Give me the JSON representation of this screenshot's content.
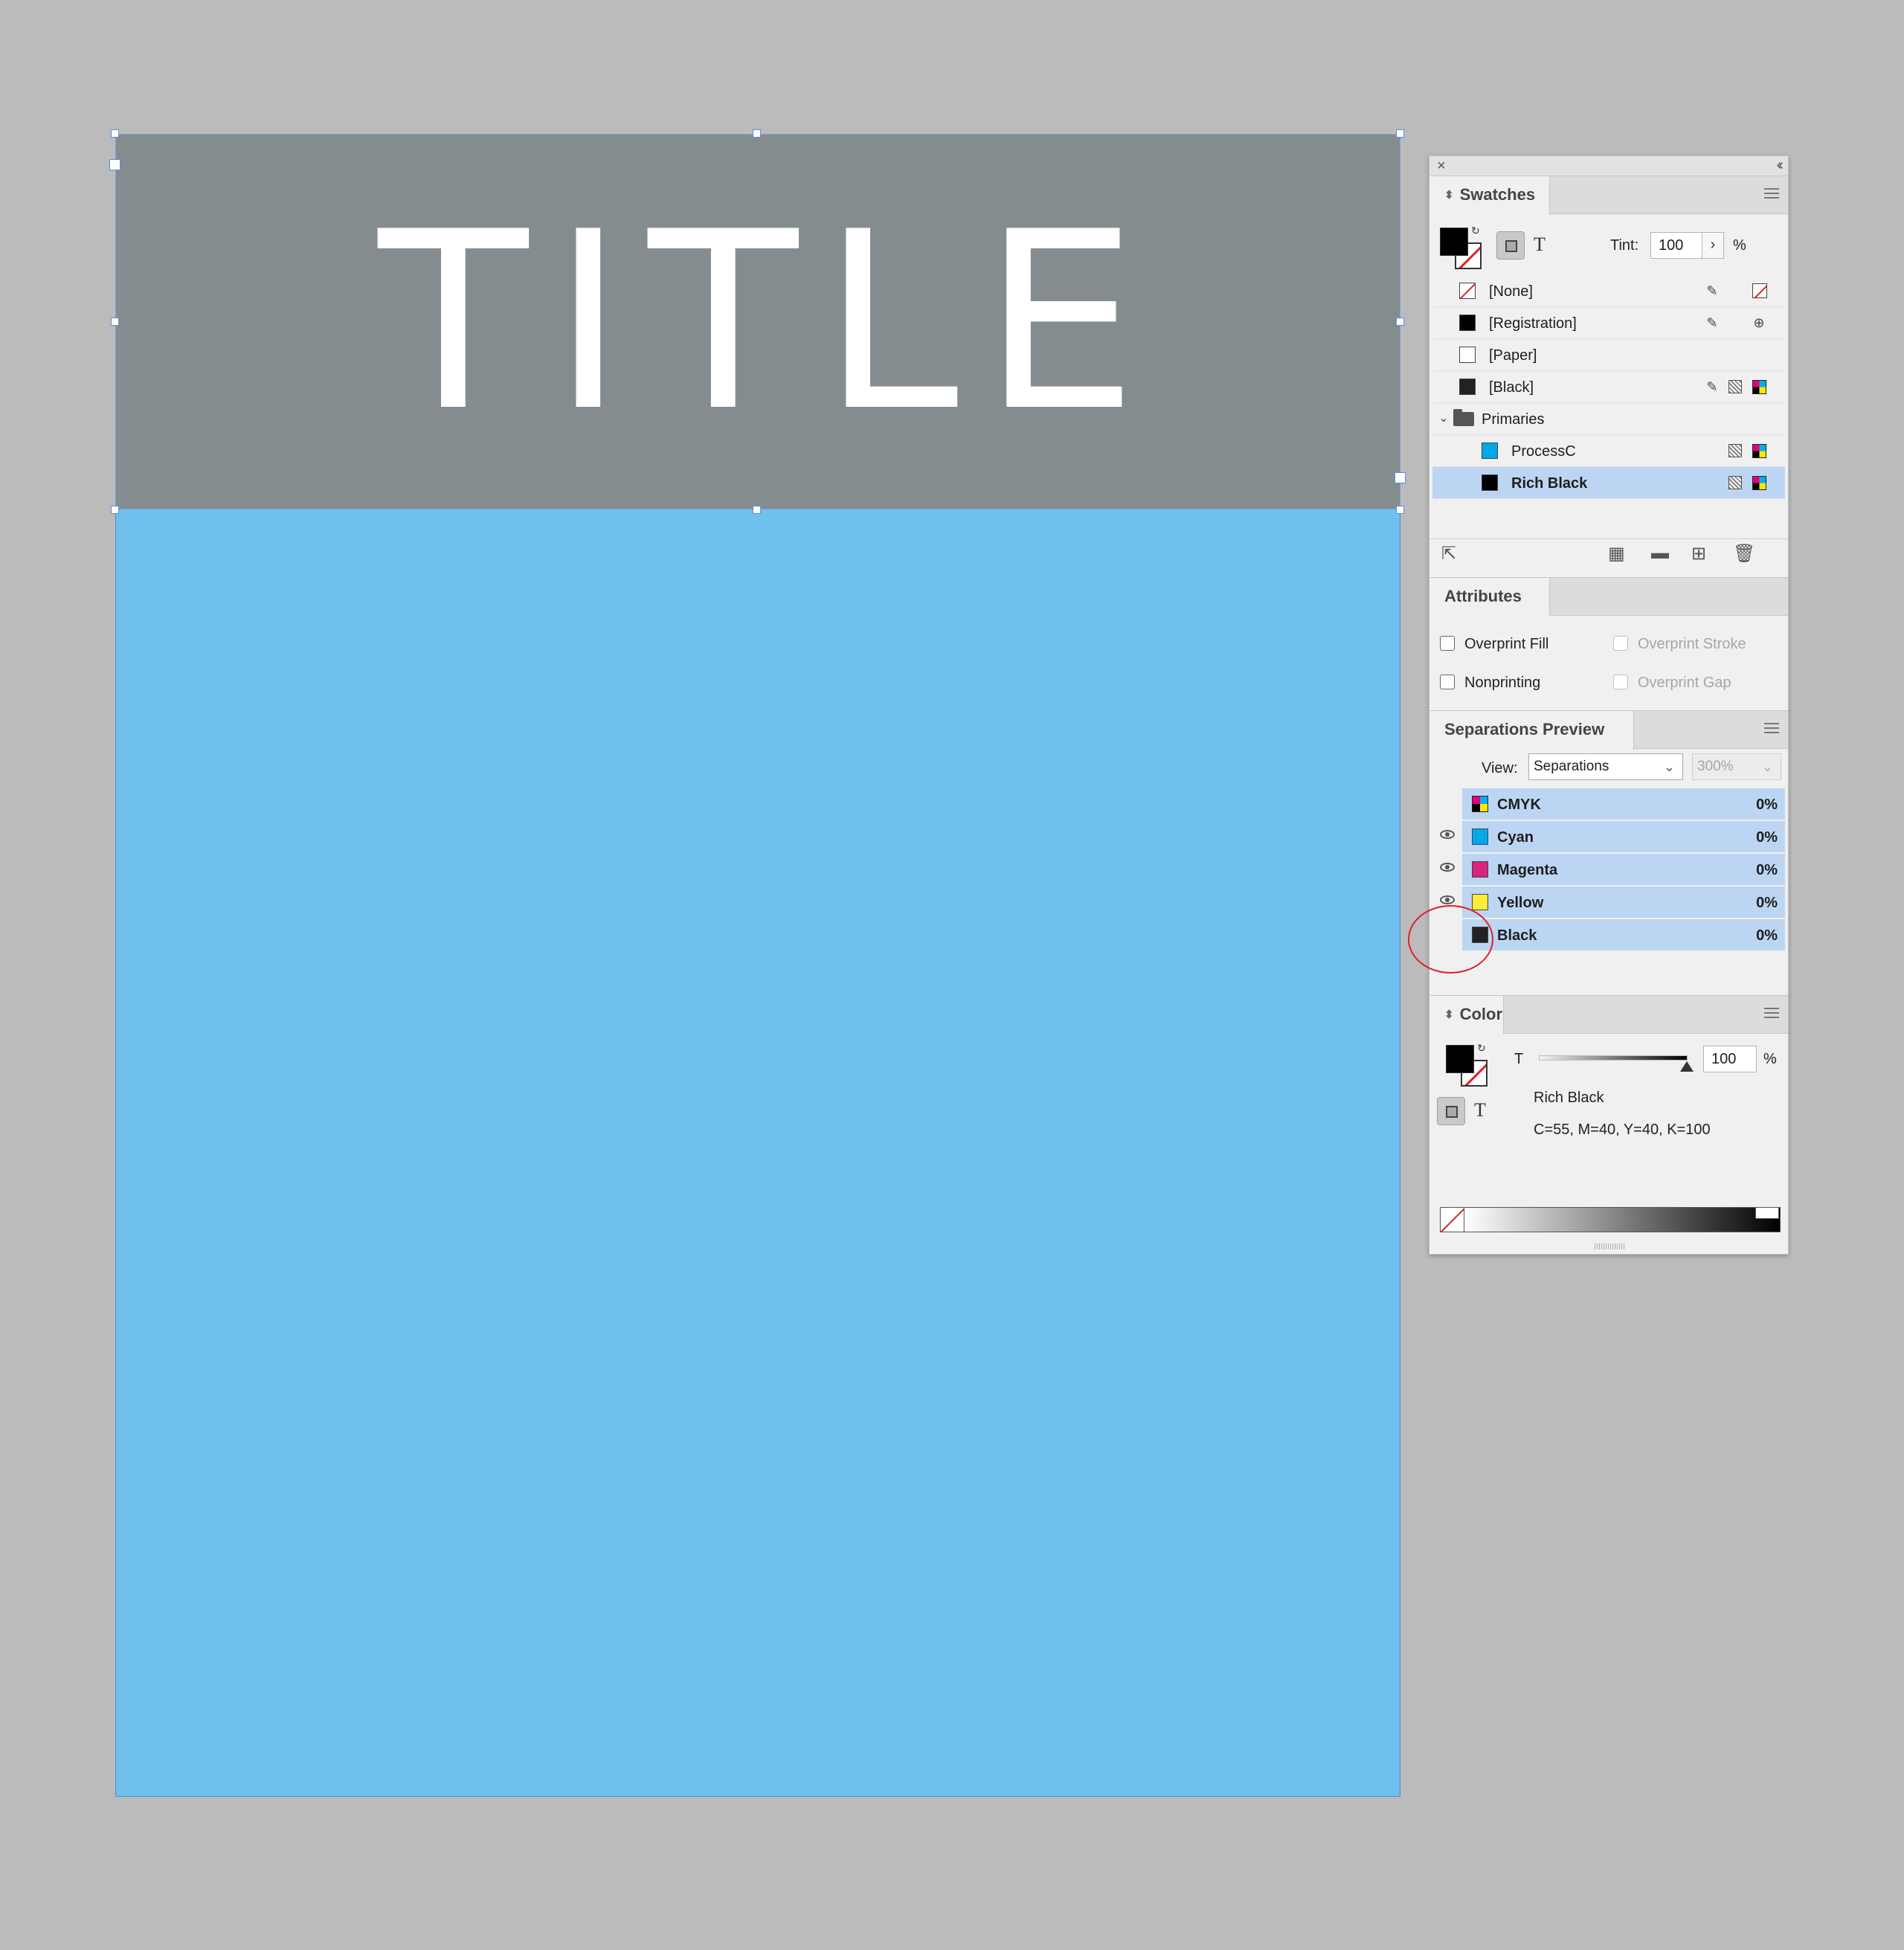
{
  "document": {
    "title_text": "TITLE"
  },
  "swatches": {
    "tab_label": "Swatches",
    "tint_label": "Tint:",
    "tint_value": "100",
    "tint_unit": "%",
    "items": [
      {
        "name": "[None]"
      },
      {
        "name": "[Registration]"
      },
      {
        "name": "[Paper]"
      },
      {
        "name": "[Black]"
      },
      {
        "name": "Primaries"
      },
      {
        "name": "ProcessC"
      },
      {
        "name": "Rich Black"
      }
    ]
  },
  "attributes": {
    "tab_label": "Attributes",
    "overprint_fill": "Overprint Fill",
    "overprint_stroke": "Overprint Stroke",
    "nonprinting": "Nonprinting",
    "overprint_gap": "Overprint Gap"
  },
  "separations": {
    "tab_label": "Separations Preview",
    "view_label": "View:",
    "view_value": "Separations",
    "zoom_value": "300%",
    "rows": [
      {
        "name": "CMYK",
        "value": "0%"
      },
      {
        "name": "Cyan",
        "value": "0%"
      },
      {
        "name": "Magenta",
        "value": "0%"
      },
      {
        "name": "Yellow",
        "value": "0%"
      },
      {
        "name": "Black",
        "value": "0%"
      }
    ]
  },
  "color": {
    "tab_label": "Color",
    "t_label": "T",
    "tint_value": "100",
    "tint_unit": "%",
    "swatch_name": "Rich Black",
    "formula": "C=55, M=40, Y=40, K=100"
  },
  "colors": {
    "page_blue": "#6fc0ee",
    "title_frame": "#858c90",
    "selection": "#bcd5f2",
    "cyan": "#00a8e8",
    "magenta": "#d6247f",
    "yellow": "#ffeb3b",
    "annotation_red": "#e01f26"
  }
}
